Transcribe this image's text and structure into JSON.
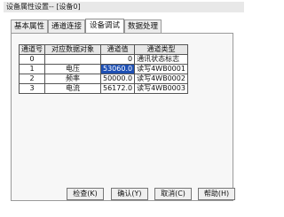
{
  "window": {
    "title": "设备属性设置-- [设备0]"
  },
  "tabs": [
    {
      "label": "基本属性",
      "active": false
    },
    {
      "label": "通道连接",
      "active": false
    },
    {
      "label": "设备调试",
      "active": true
    },
    {
      "label": "数据处理",
      "active": false
    }
  ],
  "table": {
    "headers": [
      "通道号",
      "对应数据对象",
      "通道值",
      "通道类型"
    ],
    "rows": [
      {
        "channel": "0",
        "object": "",
        "value": "0",
        "type": "通讯状态标志"
      },
      {
        "channel": "1",
        "object": "电压",
        "value": "53060.0",
        "type": "读写4WB0001"
      },
      {
        "channel": "2",
        "object": "频率",
        "value": "50000.0",
        "type": "读写4WB0002"
      },
      {
        "channel": "3",
        "object": "电流",
        "value": "56172.0",
        "type": "读写4WB0003"
      }
    ],
    "selected_value_row": 1
  },
  "buttons": {
    "check": "检查(K)",
    "confirm": "确认(Y)",
    "cancel": "取消(C)",
    "help": "帮助(H)"
  }
}
